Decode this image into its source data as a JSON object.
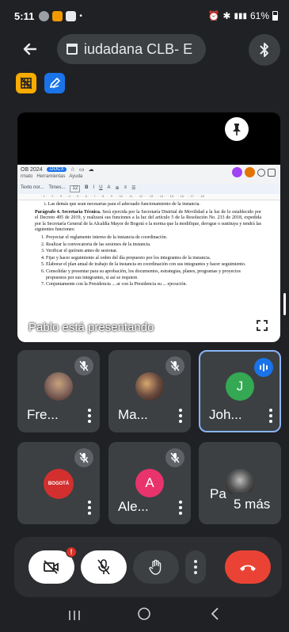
{
  "status": {
    "time": "5:11",
    "battery": "61%"
  },
  "meeting": {
    "title": "iudadana CLB- E"
  },
  "presentation": {
    "overlay_text": "Pablo está presentando",
    "doc": {
      "tab_name": "OB 2024",
      "file_badge": ".DOCX",
      "menu_items": [
        "rmato",
        "Herramientas",
        "Ayuda"
      ],
      "toolbar_text": "Texto nor...",
      "font_text": "Times...",
      "font_size": "12",
      "line_top": "Las demás que sean necesarias para el adecuado funcionamiento de la instancia.",
      "paragraph_title": "Parágrafo 4. Secretaría Técnica.",
      "paragraph_body": "Será ejercida por la Secretaría Distrital de Movilidad a la luz de lo establecido por el Decreto 495 de 2019, y realizará sus funciones a la luz del artículo 5 de la Resolución No. 233 de 2018, expedida por la Secretaría General de la Alcaldía Mayor de Bogotá o la norma que la modifique, derogue o sustituya y tendrá las siguientes funciones:",
      "list": [
        "Proyectar el reglamento interno de la instancia de coordinación.",
        "Realizar la convocatoria de las sesiones de la instancia.",
        "Verificar el quórum antes de sesionar.",
        "Fijar y hacer seguimiento al orden del día propuesto por los integrantes de la instancia.",
        "Elaborar el plan anual de trabajo de la instancia en coordinación con sus integrantes y hacer seguimiento.",
        "Consolidar y presentar para su aprobación, los documentos, estrategias, planes, programas y proyectos propuestos por sus integrantes, si así se requiere.",
        "Conjuntamente con la Presidencia ... ar con la Presidencia su ... ejecución."
      ]
    }
  },
  "participants": [
    {
      "name": "Fre...",
      "muted": true,
      "avatar_type": "photo",
      "avatar_color": "#8d6e63"
    },
    {
      "name": "Ma...",
      "muted": true,
      "avatar_type": "photo",
      "avatar_color": "#6d4c41"
    },
    {
      "name": "Joh...",
      "muted": false,
      "speaking": true,
      "avatar_type": "initial",
      "initial": "J",
      "avatar_color": "#34a853"
    },
    {
      "name": "",
      "muted": true,
      "avatar_type": "logo",
      "logo_text": "BOGOTÁ",
      "avatar_color": "#d32f2f"
    },
    {
      "name": "Ale...",
      "muted": true,
      "avatar_type": "initial",
      "initial": "A",
      "avatar_color": "#e8336d"
    },
    {
      "name": "Pa",
      "muted": false,
      "avatar_type": "photo",
      "avatar_color": "#555555",
      "more_label": "5 más"
    }
  ],
  "controls": {
    "notification_badge": "!"
  },
  "colors": {
    "background": "#202124",
    "tile": "#3c4043",
    "accent_blue": "#8ab4f8",
    "end_call": "#ea4335"
  }
}
